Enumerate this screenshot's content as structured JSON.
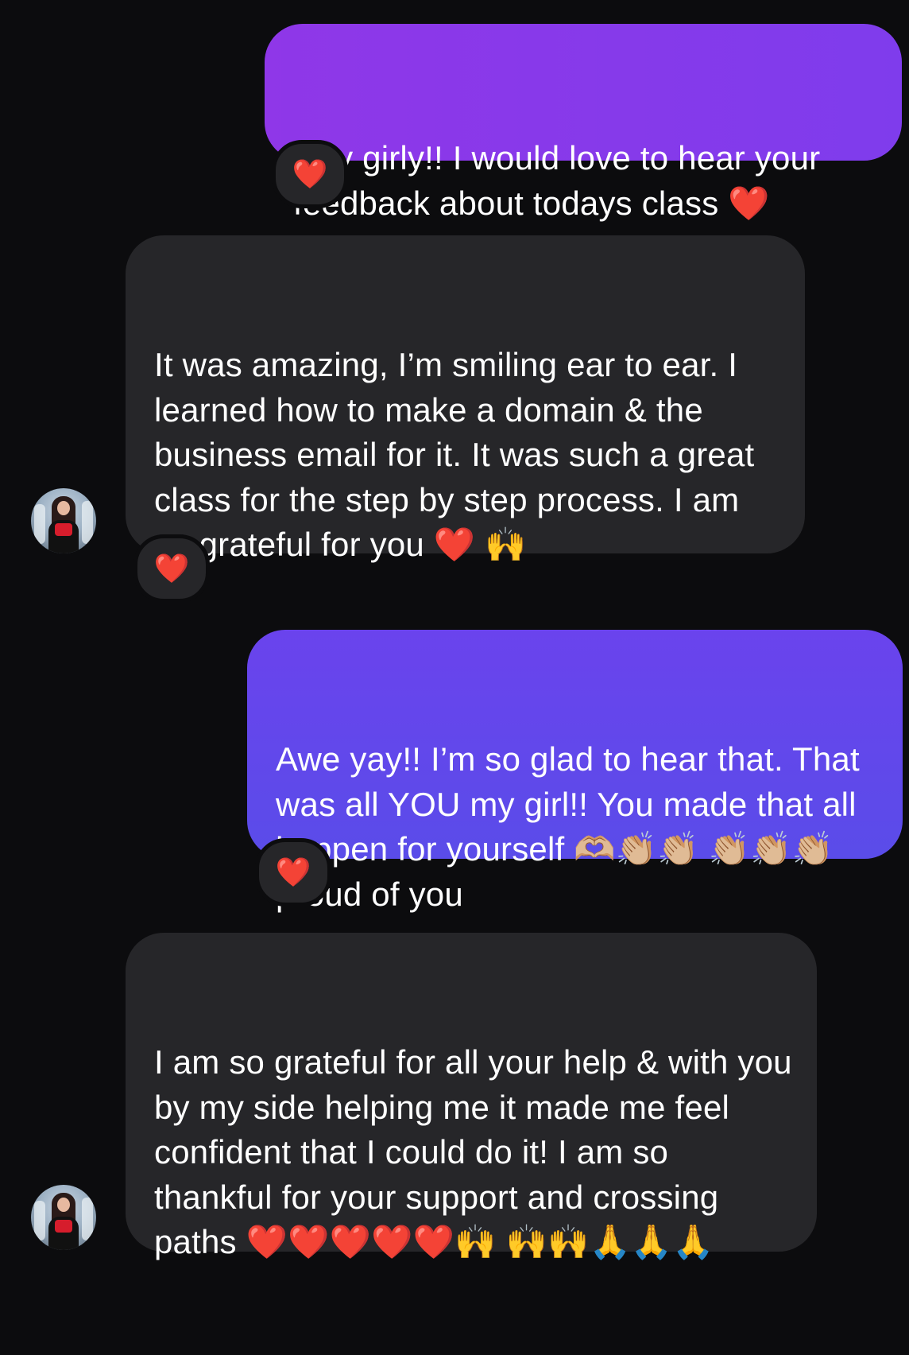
{
  "messages": [
    {
      "sender": "me",
      "text": "Hey girly!! I would love to hear your feedback about todays class ❤️",
      "reaction": "❤️"
    },
    {
      "sender": "them",
      "text": "It was amazing, I’m smiling ear to ear. I learned how to make a domain & the business email for it. It was such a great class for the step by step process. I am so grateful for you ❤️ 🙌",
      "reaction": "❤️"
    },
    {
      "sender": "me",
      "text": "Awe yay!! I’m so glad to hear that. That was all YOU my girl!! You made that all happen for yourself 🫶🏼👏🏼👏🏼 👏🏼👏🏼👏🏼 proud of you",
      "reaction": "❤️"
    },
    {
      "sender": "them",
      "text": "I am so grateful for all your help & with you by my side helping me it made me feel confident that I could do it! I am so thankful for your support and crossing paths ❤️❤️❤️❤️❤️🙌 🙌🙌🙏🙏🙏",
      "reaction": ""
    }
  ],
  "colors": {
    "background": "#0c0c0e",
    "incoming_bubble": "#262629",
    "outgoing_bubble_top": "#8f37e8",
    "outgoing_bubble_bottom": "#5a4ce9",
    "text": "#ffffff",
    "heart": "#ff2f45"
  },
  "icons": {
    "avatar": "contact-avatar-photo",
    "reaction": "red-heart-emoji"
  }
}
